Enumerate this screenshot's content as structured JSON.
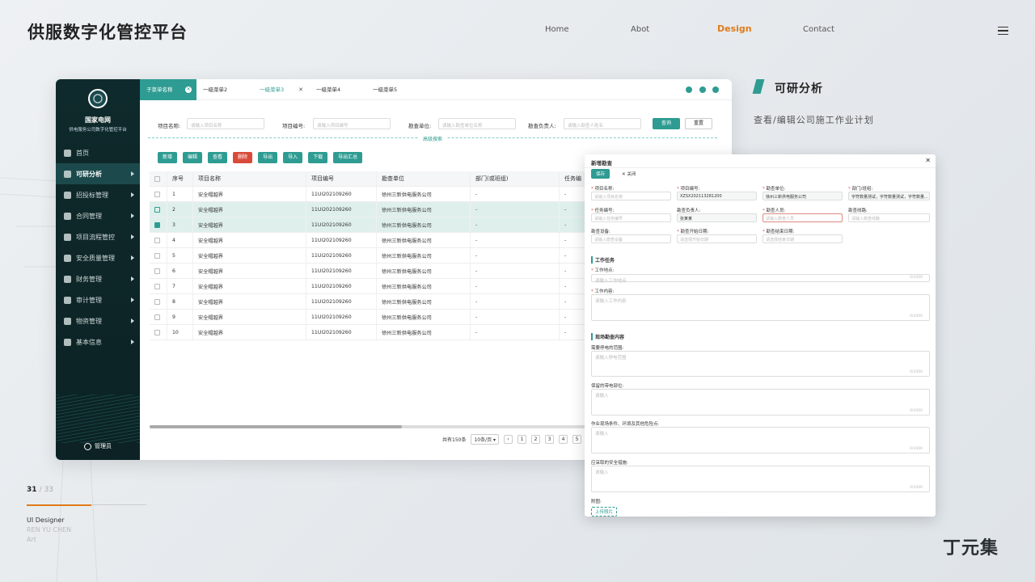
{
  "header": {
    "title": "供服数字化管控平台",
    "nav": [
      "Home",
      "Abot",
      "Design",
      "Contact"
    ]
  },
  "sidebar": {
    "org": "国家电网",
    "sub": "供电服务公司数字化管控平台",
    "items": [
      "首页",
      "可研分析",
      "招投标管理",
      "合同管理",
      "项目流程管控",
      "安全质量管理",
      "财务管理",
      "审计管理",
      "物资管理",
      "基本信息"
    ],
    "admin": "管理员"
  },
  "tabs": [
    "子菜单名称",
    "一级菜单2",
    "一级菜单3",
    "一级菜单4",
    "一级菜单5"
  ],
  "search": {
    "labels": [
      "项目名称:",
      "项目编号:",
      "勘查单位:",
      "勘查负责人:"
    ],
    "placeholders": [
      "请输入项目名称",
      "请输入项目编号",
      "请输入勘查单位名称",
      "请输入勘查人姓名"
    ],
    "query": "查询",
    "reset": "重置",
    "advanced": "高级搜索"
  },
  "actions": [
    "新增",
    "编辑",
    "查看",
    "删除",
    "导出",
    "导入",
    "下载",
    "导出汇总"
  ],
  "table": {
    "headers": [
      "序号",
      "项目名称",
      "项目编号",
      "勘查单位",
      "部门(或班组)",
      "任务编"
    ],
    "rows": [
      [
        "1",
        "安全帽越界",
        "11UI202109260",
        "徐州三新供电服务公司",
        "-",
        "-"
      ],
      [
        "2",
        "安全帽越界",
        "11UI202109260",
        "徐州三新供电服务公司",
        "-",
        "-"
      ],
      [
        "3",
        "安全帽越界",
        "11UI202109260",
        "徐州三新供电服务公司",
        "-",
        "-"
      ],
      [
        "4",
        "安全帽越界",
        "11UI202109260",
        "徐州三新供电服务公司",
        "-",
        "-"
      ],
      [
        "5",
        "安全帽越界",
        "11UI202109260",
        "徐州三新供电服务公司",
        "-",
        "-"
      ],
      [
        "6",
        "安全帽越界",
        "11UI202109260",
        "徐州三新供电服务公司",
        "-",
        "-"
      ],
      [
        "7",
        "安全帽越界",
        "11UI202109260",
        "徐州三新供电服务公司",
        "-",
        "-"
      ],
      [
        "8",
        "安全帽越界",
        "11UI202109260",
        "徐州三新供电服务公司",
        "-",
        "-"
      ],
      [
        "9",
        "安全帽越界",
        "11UI202109260",
        "徐州三新供电服务公司",
        "-",
        "-"
      ],
      [
        "10",
        "安全帽越界",
        "11UI202109260",
        "徐州三新供电服务公司",
        "-",
        "-"
      ]
    ]
  },
  "pager": {
    "total": "共有150条",
    "size": "10条/页",
    "pages": [
      "1",
      "2",
      "3",
      "4",
      "5"
    ]
  },
  "dialog": {
    "title": "新增勘查",
    "save": "保存",
    "close": "关闭",
    "fields": [
      {
        "label": "项目名称:",
        "value": "请输入项目名称"
      },
      {
        "label": "项目编号:",
        "value": "XZSX202113281200"
      },
      {
        "label": "勘查单位:",
        "value": "徐州三新供电服务公司"
      },
      {
        "label": "部门/班组:",
        "value": "字符数量测试，字符数量测试，字符数量..."
      },
      {
        "label": "任务编号:",
        "value": "请输入任务编号"
      },
      {
        "label": "勘查负责人:",
        "value": "张某某"
      },
      {
        "label": "勘查人员:",
        "value": "请输入勘查人员"
      },
      {
        "label": "勘查线路:",
        "value": "请输入勘查线路"
      },
      {
        "label": "勘查设备:",
        "value": "请输入勘查设备"
      },
      {
        "label": "勘查开始日期:",
        "value": "请选择开始日期"
      },
      {
        "label": "勘查结束日期:",
        "value": "请选择结束日期"
      }
    ],
    "sec1": "工作任务",
    "work_place": "工作地点:",
    "work_place_ph": "请输入工作地点",
    "work_content": "工作内容:",
    "work_content_ph": "请输入工作内容",
    "sec2": "现场勘查内容",
    "blocks": [
      {
        "label": "需要停电的范围:",
        "ph": "请输入停电范围"
      },
      {
        "label": "保留的带电部位:",
        "ph": "请输入"
      },
      {
        "label": "作业现场条件、环境及其他危险点:",
        "ph": "请输入"
      },
      {
        "label": "应采取的安全措施:",
        "ph": "请输入"
      }
    ],
    "attach": "附图:",
    "upload": "上传照片",
    "count": "0/1000"
  },
  "right": {
    "title": "可研分析",
    "desc": "查看/编辑公司施工作业计划"
  },
  "footer": {
    "page": "31",
    "total": "/ 33",
    "role": "UI Designer",
    "name": "REN YU CHEN",
    "art": "Art",
    "sig": "丁元集"
  },
  "colors": {
    "accent": "#2e9c92",
    "danger": "#d94a3a",
    "orange": "#e07b1a",
    "sidebar": "#0f2a2c"
  }
}
